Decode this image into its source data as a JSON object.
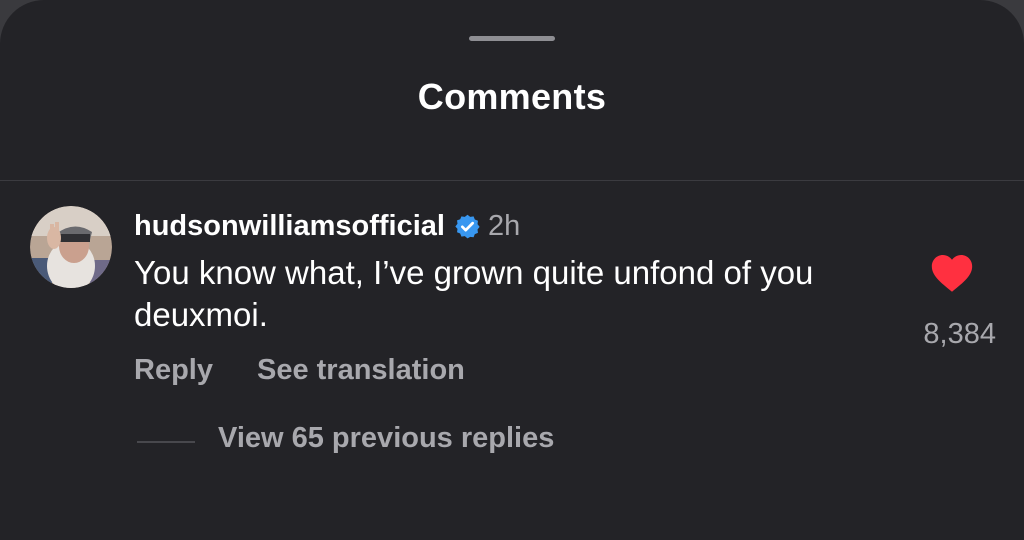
{
  "sheet": {
    "title": "Comments"
  },
  "comment": {
    "username": "hudsonwilliamsofficial",
    "verified": true,
    "time": "2h",
    "text": "You know what, I’ve grown quite unfond of you deuxmoi.",
    "liked": true,
    "like_count": "8,384",
    "actions": {
      "reply": "Reply",
      "see_translation": "See translation"
    },
    "view_replies": "View 65 previous replies"
  },
  "colors": {
    "background": "#232327",
    "text_primary": "#ffffff",
    "text_secondary": "#a8a8ad",
    "verified_badge": "#3897f0",
    "like_heart": "#ff3040"
  }
}
